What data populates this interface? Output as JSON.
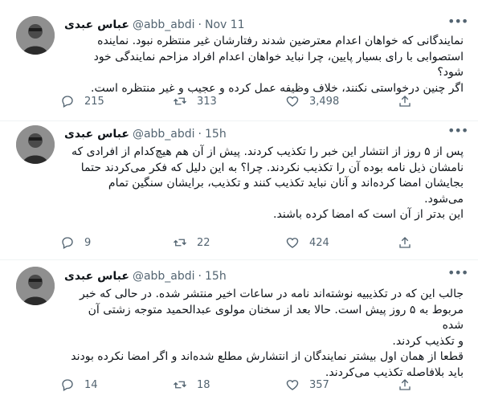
{
  "tweets": [
    {
      "name": "عباس عبدی",
      "handle": "@abb_abdi",
      "dot": "·",
      "time": "Nov 11",
      "lines": [
        "نمایندگانی که خواهان اعدام معترضین شدند رفتارشان غیر منتظره نبود. نماینده",
        "استصوابی با رای بسیار پایین، چرا نباید خواهان اعدام افراد مزاحم نمایندگی خود شود؟",
        "اگر چنین درخواستی نکنند، خلاف وظیفه عمل کرده و عجیب و غیر منتظره است."
      ],
      "replies": "215",
      "retweets": "313",
      "likes": "3,498"
    },
    {
      "name": "عباس عبدی",
      "handle": "@abb_abdi",
      "dot": "·",
      "time": "15h",
      "lines": [
        "پس از ۵ روز از انتشار این خبر را تکذیب کردند. پیش از آن هم هیچ‌کدام از افرادی که",
        "نامشان ذیل نامه بوده آن را تکذیب نکردند. چرا؟ به این دلیل که فکر می‌کردند حتما",
        "بجایشان امضا کرده‌اند و آنان نباید تکذیب کنند و تکذیب، برایشان سنگین تمام",
        "می‌شود.",
        "این بدتر از آن است که امضا کرده باشند."
      ],
      "replies": "9",
      "retweets": "22",
      "likes": "424"
    },
    {
      "name": "عباس عبدی",
      "handle": "@abb_abdi",
      "dot": "·",
      "time": "15h",
      "lines": [
        "جالب این که در تکذیبیه نوشته‌اند نامه در ساعات اخیر منتشر شده. در حالی که خبر",
        "مربوط به ۵ روز پیش است. حالا بعد از سخنان مولوی عبدالحمید متوجه زشتی آن شده",
        "و تکذیب کردند.",
        "قطعا از همان اول بیشتر نمایندگان از انتشارش مطلع شده‌اند و اگر امضا نکرده بودند",
        "باید بلافاصله تکذیب می‌کردند."
      ],
      "replies": "14",
      "retweets": "18",
      "likes": "357"
    }
  ],
  "icons": {
    "more": "more-horizontal-icon",
    "reply": "reply-icon",
    "retweet": "retweet-icon",
    "like": "heart-icon",
    "share": "share-icon"
  },
  "colors": {
    "text": "#0f1419",
    "secondary": "#536471",
    "divider": "#eff3f4"
  }
}
